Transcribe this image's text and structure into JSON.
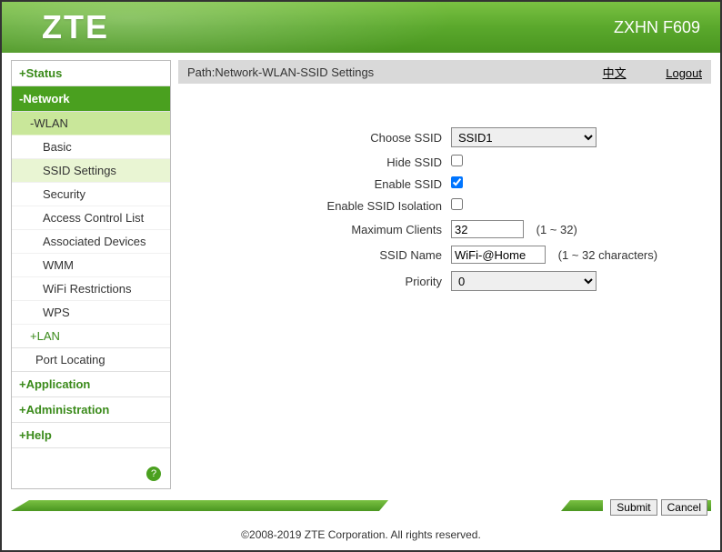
{
  "header": {
    "brand": "ZTE",
    "model": "ZXHN F609"
  },
  "sidebar": {
    "sections": {
      "status": "+Status",
      "network": "-Network",
      "wlan": "-WLAN",
      "lan": "+LAN",
      "port_locating": "Port Locating",
      "application": "+Application",
      "administration": "+Administration",
      "help": "+Help"
    },
    "wlan_items": {
      "basic": "Basic",
      "ssid_settings": "SSID Settings",
      "security": "Security",
      "acl": "Access Control List",
      "assoc": "Associated Devices",
      "wmm": "WMM",
      "restrictions": "WiFi Restrictions",
      "wps": "WPS"
    }
  },
  "path": {
    "label": "Path:Network-WLAN-SSID Settings",
    "lang": "中文",
    "logout": "Logout"
  },
  "form": {
    "choose_ssid": {
      "label": "Choose SSID",
      "value": "SSID1"
    },
    "hide_ssid": {
      "label": "Hide SSID",
      "checked": false
    },
    "enable_ssid": {
      "label": "Enable SSID",
      "checked": true
    },
    "isolation": {
      "label": "Enable SSID Isolation",
      "checked": false
    },
    "max_clients": {
      "label": "Maximum Clients",
      "value": "32",
      "hint": "(1 ~ 32)"
    },
    "ssid_name": {
      "label": "SSID Name",
      "value": "WiFi-@Home",
      "hint": "(1 ~ 32 characters)"
    },
    "priority": {
      "label": "Priority",
      "value": "0"
    }
  },
  "buttons": {
    "submit": "Submit",
    "cancel": "Cancel"
  },
  "footer": "©2008-2019 ZTE Corporation. All rights reserved."
}
